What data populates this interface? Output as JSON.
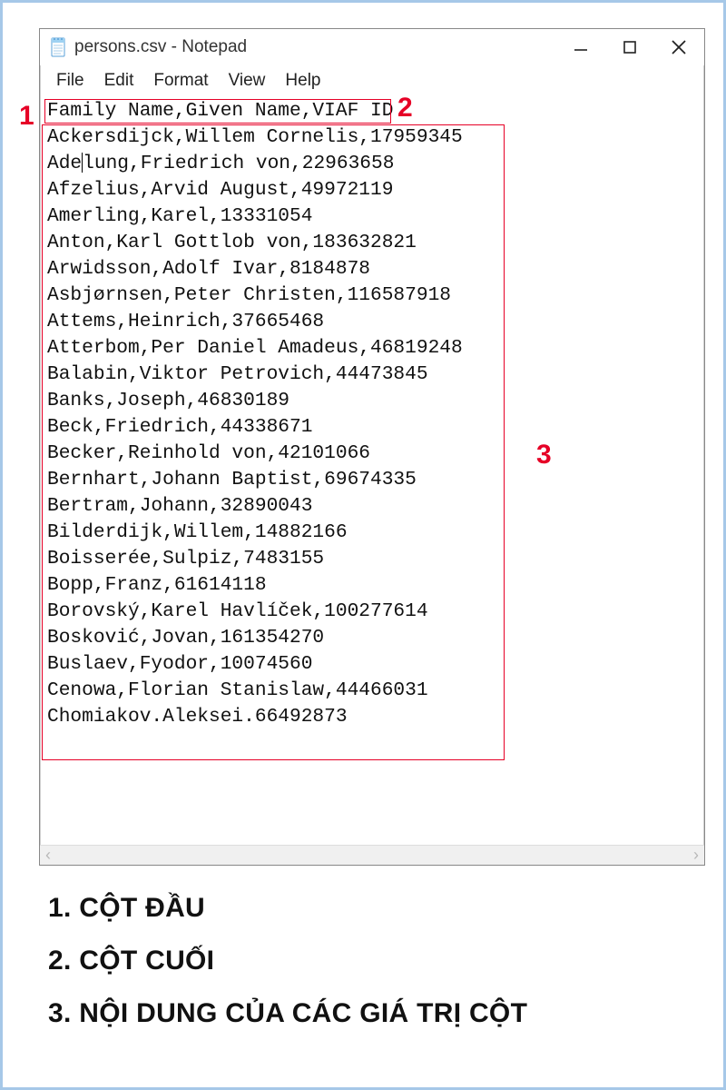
{
  "window": {
    "title": "persons.csv - Notepad"
  },
  "menu": {
    "file": "File",
    "edit": "Edit",
    "format": "Format",
    "view": "View",
    "help": "Help"
  },
  "editor": {
    "header_line": "Family Name,Given Name,VIAF ID",
    "lines": [
      "Ackersdijck,Willem Cornelis,17959345",
      "Adelung,Friedrich von,22963658",
      "Afzelius,Arvid August,49972119",
      "Amerling,Karel,13331054",
      "Anton,Karl Gottlob von,183632821",
      "Arwidsson,Adolf Ivar,8184878",
      "Asbjørnsen,Peter Christen,116587918",
      "Attems,Heinrich,37665468",
      "Atterbom,Per Daniel Amadeus,46819248",
      "Balabin,Viktor Petrovich,44473845",
      "Banks,Joseph,46830189",
      "Beck,Friedrich,44338671",
      "Becker,Reinhold von,42101066",
      "Bernhart,Johann Baptist,69674335",
      "Bertram,Johann,32890043",
      "Bilderdijk,Willem,14882166",
      "Boisserée,Sulpiz,7483155",
      "Bopp,Franz,61614118",
      "Borovský,Karel Havlíček,100277614",
      "Bosković,Jovan,161354270",
      "Buslaev,Fyodor,10074560",
      "Cenowa,Florian Stanislaw,44466031",
      "Chomiakov.Aleksei.66492873"
    ],
    "caret_line_partA": "Ade",
    "caret_line_partB": "lung,Friedrich von,22963658"
  },
  "markers": {
    "m1": "1",
    "m2": "2",
    "m3": "3"
  },
  "legend": {
    "l1": "1. CỘT ĐẦU",
    "l2": "2. CỘT CUỐI",
    "l3": "3. NỘI DUNG CỦA CÁC GIÁ TRỊ CỘT"
  }
}
